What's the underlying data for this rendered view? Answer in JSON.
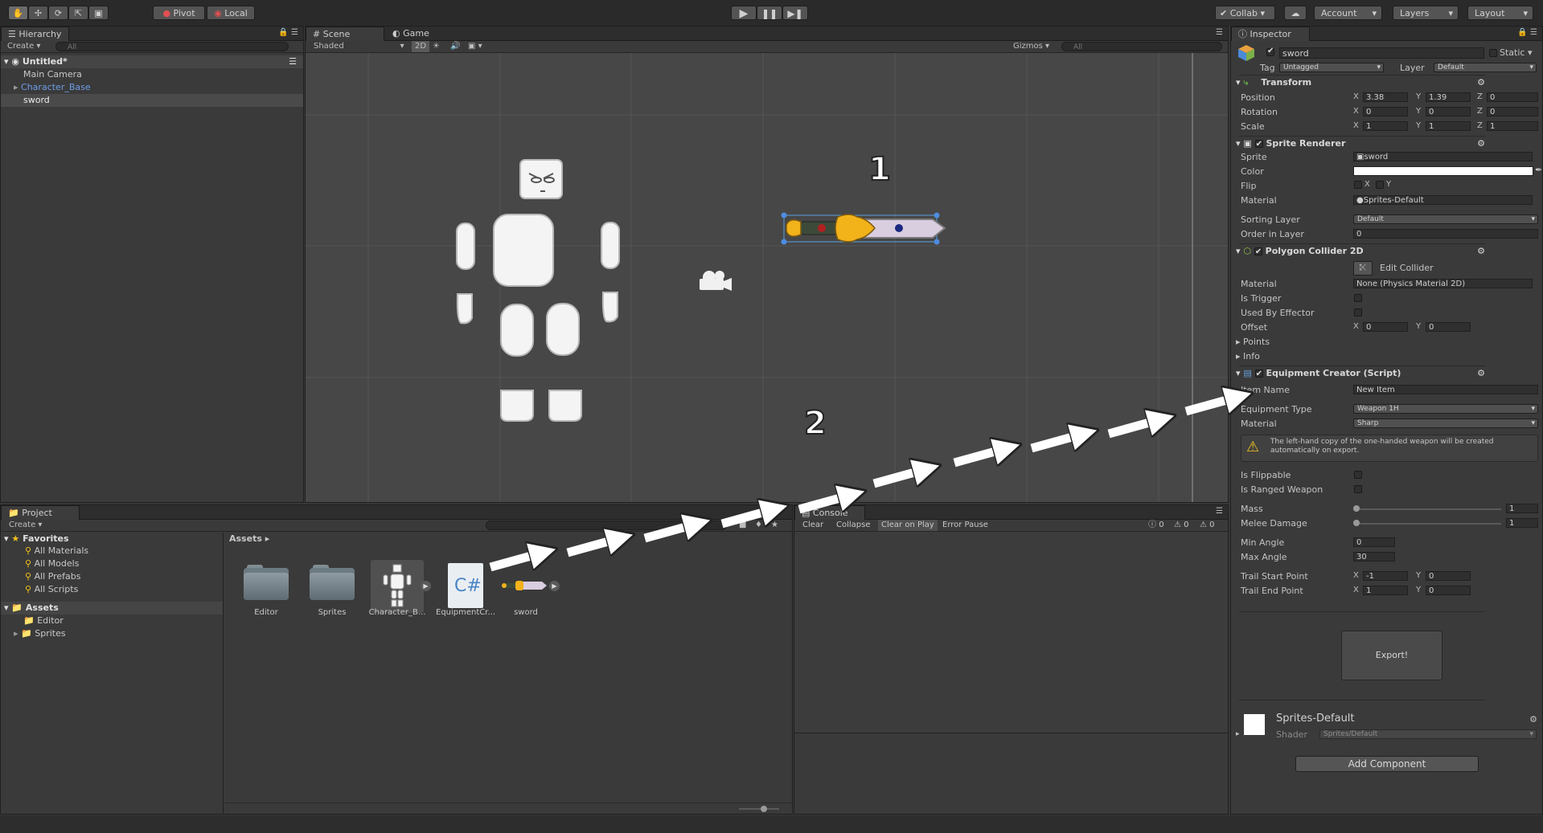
{
  "toolbar": {
    "pivot": "Pivot",
    "local": "Local",
    "collab": "Collab",
    "account": "Account",
    "layers": "Layers",
    "layout": "Layout"
  },
  "hierarchy": {
    "tab": "Hierarchy",
    "create": "Create",
    "search": "All",
    "scene_name": "Untitled*",
    "items": [
      "Main Camera",
      "Character_Base",
      "sword"
    ]
  },
  "scene": {
    "tab_scene": "Scene",
    "tab_game": "Game",
    "shading": "Shaded",
    "mode_2d": "2D",
    "gizmos": "Gizmos",
    "search": "All",
    "annotation_1": "1",
    "annotation_2": "2"
  },
  "project": {
    "tab": "Project",
    "create": "Create",
    "favorites_header": "Favorites",
    "favorites": [
      "All Materials",
      "All Models",
      "All Prefabs",
      "All Scripts"
    ],
    "assets_header": "Assets",
    "asset_folders": [
      "Editor",
      "Sprites"
    ],
    "breadcrumb": "Assets",
    "assets": [
      "Editor",
      "Sprites",
      "Character_B...",
      "EquipmentCr...",
      "sword"
    ]
  },
  "console": {
    "tab": "Console",
    "buttons": [
      "Clear",
      "Collapse",
      "Clear on Play",
      "Error Pause"
    ],
    "counts": [
      "0",
      "0",
      "0"
    ]
  },
  "inspector": {
    "tab": "Inspector",
    "object_name": "sword",
    "static_label": "Static",
    "tag_label": "Tag",
    "tag_value": "Untagged",
    "layer_label": "Layer",
    "layer_value": "Default",
    "transform": {
      "title": "Transform",
      "position_label": "Position",
      "rotation_label": "Rotation",
      "scale_label": "Scale",
      "position": [
        "3.38",
        "1.39",
        "0"
      ],
      "rotation": [
        "0",
        "0",
        "0"
      ],
      "scale": [
        "1",
        "1",
        "1"
      ]
    },
    "sprite_renderer": {
      "title": "Sprite Renderer",
      "sprite_label": "Sprite",
      "sprite_value": "sword",
      "color_label": "Color",
      "flip_label": "Flip",
      "flip_x": "X",
      "flip_y": "Y",
      "material_label": "Material",
      "material_value": "Sprites-Default",
      "sorting_layer_label": "Sorting Layer",
      "sorting_layer_value": "Default",
      "order_label": "Order in Layer",
      "order_value": "0"
    },
    "polygon_collider": {
      "title": "Polygon Collider 2D",
      "edit_collider": "Edit Collider",
      "material_label": "Material",
      "material_value": "None (Physics Material 2D)",
      "is_trigger": "Is Trigger",
      "used_by_effector": "Used By Effector",
      "offset_label": "Offset",
      "offset": [
        "0",
        "0"
      ],
      "points": "Points",
      "info": "Info"
    },
    "equipment_creator": {
      "title": "Equipment Creator (Script)",
      "item_name_label": "Item Name",
      "item_name_value": "New Item",
      "equipment_type_label": "Equipment Type",
      "equipment_type_value": "Weapon 1H",
      "material_label": "Material",
      "material_value": "Sharp",
      "warning": "The left-hand copy of the one-handed weapon will be created automatically on export.",
      "is_flippable": "Is Flippable",
      "is_ranged": "Is Ranged Weapon",
      "mass_label": "Mass",
      "mass_value": "1",
      "melee_label": "Melee Damage",
      "melee_value": "1",
      "min_angle_label": "Min Angle",
      "min_angle_value": "0",
      "max_angle_label": "Max Angle",
      "max_angle_value": "30",
      "trail_start_label": "Trail Start Point",
      "trail_start": [
        "-1",
        "0"
      ],
      "trail_end_label": "Trail End Point",
      "trail_end": [
        "1",
        "0"
      ],
      "export_button": "Export!"
    },
    "material_preview": {
      "name": "Sprites-Default",
      "shader_label": "Shader",
      "shader_value": "Sprites/Default"
    },
    "add_component": "Add Component"
  },
  "colors": {
    "accent_blue": "#4e8de0",
    "selection": "#4a4a4a",
    "arrow": "#ffffff"
  }
}
